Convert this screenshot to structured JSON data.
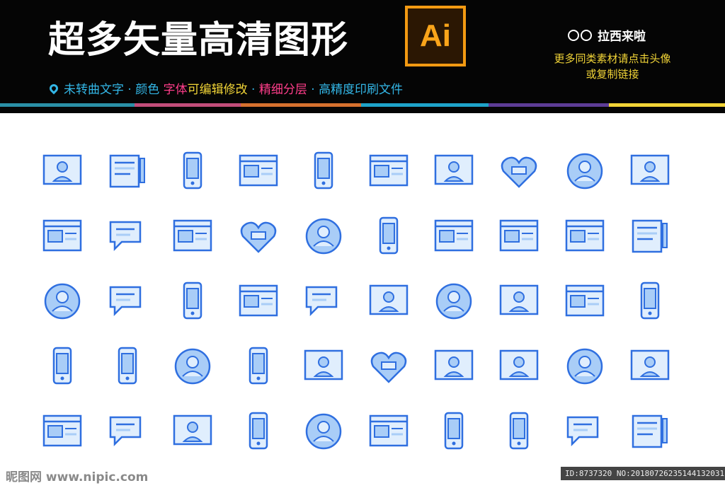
{
  "banner": {
    "title": "超多矢量高清图形",
    "logo_text": "Ai",
    "brand": "拉西来啦",
    "promo_line1": "更多同类素材请点击头像",
    "promo_line2": "或复制链接",
    "features": [
      {
        "text": "未转曲文字",
        "color": "#33b6e6"
      },
      {
        "text": " · ",
        "color": "#33b6e6"
      },
      {
        "text": "颜色 ",
        "color": "#33b6e6"
      },
      {
        "text": "字体",
        "color": "#ff3d8a"
      },
      {
        "text": "可编辑修改",
        "color": "#f1d437"
      },
      {
        "text": " · ",
        "color": "#33b6e6"
      },
      {
        "text": "精细分层",
        "color": "#ff3d8a"
      },
      {
        "text": " · ",
        "color": "#33b6e6"
      },
      {
        "text": "高精度印刷文件",
        "color": "#33b6e6"
      }
    ],
    "color_bar": [
      "#2a8fa6",
      "#c24d7a",
      "#d6702e",
      "#1ea3c9",
      "#5d3c96",
      "#f1d437"
    ]
  },
  "icons": [
    [
      "profile-window-icon",
      "document-pen-icon",
      "woman-phone-icon",
      "selfie-stick-icon",
      "smartphone-image-icon",
      "image-documents-icon",
      "add-user-icon",
      "like-heart-icon",
      "note-pen-icon",
      "man-chat-icon"
    ],
    [
      "id-card-icon",
      "chat-documents-icon",
      "review-stars-icon",
      "heart-message-icon",
      "video-presentation-icon",
      "phone-video-call-icon",
      "web-media-icon",
      "web-article-icon",
      "bell-touch-icon",
      "email-image-icon"
    ],
    [
      "camera-drone-icon",
      "speech-document-icon",
      "phone-messages-icon",
      "voice-recorder-icon",
      "video-chat-window-icon",
      "user-thinking-icon",
      "share-window-icon",
      "people-talking-icon",
      "typewriter-icon",
      "phone-video-icon"
    ],
    [
      "phone-profile-likes-icon",
      "hand-phone-mail-icon",
      "paper-notes-icon",
      "social-phone-icon",
      "social-network-user-icon",
      "heart-tap-icon",
      "user-network-icon",
      "profile-cards-icon",
      "article-desk-icon",
      "block-user-icon"
    ],
    [
      "podium-speaker-icon",
      "message-delete-icon",
      "newspaper-man-icon",
      "vinyl-music-phone-icon",
      "first-place-badge-icon",
      "web-upload-icon",
      "phone-chat-icon",
      "landscape-phone-user-icon",
      "keyboard-message-icon",
      "image-info-icon"
    ]
  ],
  "watermark": {
    "left": "昵图网 www.nipic.com",
    "right": "ID:8737320 NO:20180726235144132031"
  },
  "colors": {
    "icon_stroke": "#2f6fe0",
    "icon_fill": "#a9cdf7",
    "icon_accent": "#e0eefd"
  }
}
